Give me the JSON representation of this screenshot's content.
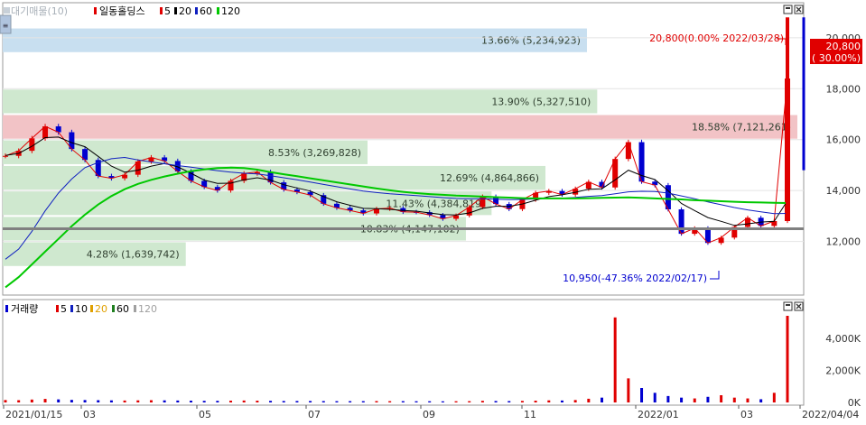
{
  "colors": {
    "up": "#e00000",
    "down": "#0000d0",
    "ma5": "#e00000",
    "ma20": "#000000",
    "ma60": "#1020c0",
    "ma120": "#00c800",
    "vprofile": "#cfe8cf",
    "vprofile_max": "#f2c3c6",
    "vprofile_top": "#c8dff0",
    "grid": "#e4e4e4"
  },
  "chart_data": [
    {
      "type": "line",
      "title": "일동홀딩스",
      "legend": {
        "placement": "top-left",
        "prefix": "대기매물(10)",
        "stock": "일동홀딩스",
        "periods": [
          "5",
          "20",
          "60",
          "120"
        ]
      },
      "icons": [
        "box-icon",
        "close-icon"
      ],
      "y_axis": {
        "side": "right",
        "ticks": [
          "12,000",
          "14,000",
          "16,000",
          "18,000",
          "20,000"
        ],
        "ylim": [
          10000,
          21200
        ]
      },
      "x_axis": {
        "ticks": [
          "2021/01/15",
          "03",
          "05",
          "07",
          "09",
          "11",
          "2022/01",
          "03",
          "2022/04/04"
        ]
      },
      "volume_profile": [
        {
          "label": "13.66% (5,234,923)",
          "pct": 13.66,
          "volume": 5234923,
          "price_range": [
            19400,
            20400
          ],
          "emphasis": "top"
        },
        {
          "label": "13.90% (5,327,510)",
          "pct": 13.9,
          "volume": 5327510,
          "price_range": [
            17000,
            18000
          ]
        },
        {
          "label": "18.58% (7,121,261)",
          "pct": 18.58,
          "volume": 7121261,
          "price_range": [
            16000,
            17000
          ],
          "emphasis": "max"
        },
        {
          "label": "8.53% (3,269,828)",
          "pct": 8.53,
          "volume": 3269828,
          "price_range": [
            15000,
            16000
          ]
        },
        {
          "label": "12.69% (4,864,866)",
          "pct": 12.69,
          "volume": 4864866,
          "price_range": [
            14000,
            15000
          ]
        },
        {
          "label": "11.43% (4,384,819)",
          "pct": 11.43,
          "volume": 4384819,
          "price_range": [
            13000,
            14000
          ]
        },
        {
          "label": "10.83% (4,147,102)",
          "pct": 10.83,
          "volume": 4147102,
          "price_range": [
            12000,
            13000
          ]
        },
        {
          "label": "4.28% (1,639,742)",
          "pct": 4.28,
          "volume": 1639742,
          "price_range": [
            11000,
            12000
          ]
        }
      ],
      "current_price": {
        "value": 20800,
        "label": "20,800",
        "change_label": "( 30.00%)"
      },
      "annotations": [
        {
          "text": "20,800(0.00% 2022/03/28)",
          "price": 20800,
          "date": "2022/03/28"
        },
        {
          "text": "10,950(-47.36% 2022/02/17)",
          "price": 10950,
          "date": "2022/02/17"
        }
      ],
      "reference_line": 12500,
      "series": [
        {
          "name": "5",
          "role": "ma5",
          "values": [
            15360,
            15560,
            16050,
            16520,
            16290,
            15630,
            15200,
            14570,
            14480,
            14620,
            15140,
            15300,
            15160,
            14750,
            14380,
            14140,
            14000,
            14380,
            14670,
            14730,
            14320,
            14040,
            13940,
            13820,
            13480,
            13320,
            13220,
            13100,
            13280,
            13310,
            13160,
            13150,
            13040,
            12890,
            13020,
            13350,
            13760,
            13470,
            13270,
            13640,
            13910,
            13980,
            13840,
            14070,
            14340,
            14120,
            15240,
            15900,
            14350,
            14210,
            13260,
            12300,
            12520,
            11940,
            12150,
            12570,
            12930,
            12610,
            12800,
            18400
          ]
        },
        {
          "name": "20",
          "role": "ma20",
          "values": [
            15380,
            15460,
            15740,
            16080,
            16100,
            15880,
            15720,
            15340,
            14960,
            14720,
            14800,
            14960,
            15060,
            14930,
            14680,
            14410,
            14280,
            14290,
            14420,
            14500,
            14410,
            14230,
            14100,
            13980,
            13760,
            13560,
            13420,
            13300,
            13290,
            13260,
            13220,
            13190,
            13120,
            13050,
            13040,
            13120,
            13300,
            13380,
            13380,
            13470,
            13620,
            13760,
            13830,
            13930,
            14050,
            14070,
            14420,
            14800,
            14590,
            14430,
            13990,
            13490,
            13210,
            12940,
            12790,
            12630,
            12690,
            12760,
            12790,
            13600
          ]
        },
        {
          "name": "60",
          "role": "ma60",
          "values": [
            11300,
            11700,
            12400,
            13200,
            13900,
            14450,
            14900,
            15100,
            15250,
            15300,
            15200,
            15120,
            15050,
            14980,
            14920,
            14850,
            14780,
            14720,
            14680,
            14650,
            14580,
            14500,
            14420,
            14330,
            14240,
            14150,
            14060,
            13980,
            13920,
            13870,
            13840,
            13800,
            13760,
            13720,
            13690,
            13680,
            13680,
            13660,
            13640,
            13650,
            13670,
            13690,
            13700,
            13730,
            13770,
            13800,
            13870,
            13950,
            13970,
            13960,
            13900,
            13790,
            13680,
            13550,
            13440,
            13330,
            13240,
            13160,
            13090,
            13100
          ]
        },
        {
          "name": "120",
          "role": "ma120",
          "values": [
            10200,
            10600,
            11100,
            11600,
            12100,
            12600,
            13050,
            13450,
            13780,
            14050,
            14260,
            14420,
            14550,
            14660,
            14760,
            14830,
            14880,
            14900,
            14880,
            14820,
            14720,
            14640,
            14560,
            14480,
            14400,
            14320,
            14240,
            14160,
            14080,
            14010,
            13950,
            13900,
            13860,
            13830,
            13800,
            13780,
            13760,
            13740,
            13720,
            13700,
            13690,
            13690,
            13690,
            13690,
            13700,
            13710,
            13720,
            13730,
            13710,
            13690,
            13670,
            13650,
            13620,
            13600,
            13580,
            13560,
            13540,
            13530,
            13520,
            13510
          ]
        }
      ]
    },
    {
      "type": "bar",
      "title": "",
      "legend": {
        "placement": "top-left",
        "label": "거래량",
        "periods": [
          "5",
          "10",
          "20",
          "60",
          "120"
        ]
      },
      "icons": [
        "box-icon",
        "close-icon"
      ],
      "y_axis": {
        "side": "right",
        "ticks": [
          "0K",
          "2,000K",
          "4,000K"
        ],
        "ylim": [
          0,
          5400000
        ]
      },
      "series": [
        {
          "name": "거래량",
          "role": "volume",
          "values": [
            150000,
            140000,
            180000,
            220000,
            190000,
            160000,
            150000,
            140000,
            130000,
            120000,
            130000,
            140000,
            130000,
            120000,
            110000,
            100000,
            100000,
            110000,
            120000,
            110000,
            100000,
            90000,
            90000,
            90000,
            85000,
            80000,
            80000,
            80000,
            85000,
            80000,
            80000,
            75000,
            75000,
            70000,
            75000,
            80000,
            100000,
            90000,
            85000,
            95000,
            110000,
            130000,
            120000,
            150000,
            230000,
            300000,
            5300000,
            1500000,
            900000,
            600000,
            400000,
            300000,
            250000,
            350000,
            450000,
            300000,
            250000,
            200000,
            600000,
            5400000
          ]
        }
      ]
    }
  ]
}
